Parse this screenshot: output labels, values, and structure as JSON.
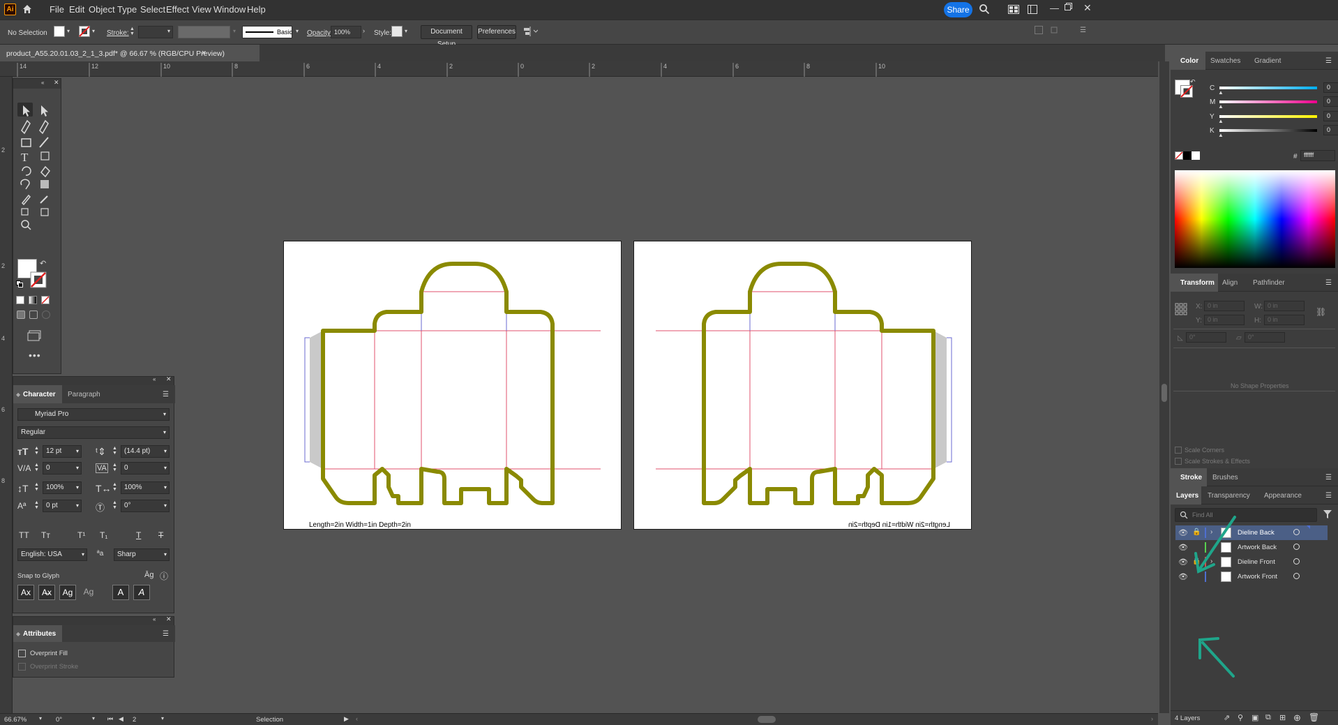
{
  "app": {
    "logo_text": "Ai"
  },
  "menu": [
    "File",
    "Edit",
    "Object",
    "Type",
    "Select",
    "Effect",
    "View",
    "Window",
    "Help"
  ],
  "share_label": "Share",
  "control_bar": {
    "selection_label": "No Selection",
    "stroke_label": "Stroke:",
    "brush_label": "Basic",
    "opacity_label": "Opacity:",
    "opacity_value": "100%",
    "style_label": "Style:",
    "document_setup": "Document Setup",
    "preferences": "Preferences"
  },
  "document_tab": {
    "title": "product_A55.20.01.03_2_1_3.pdf* @ 66.67 % (RGB/CPU Preview)",
    "close": "×"
  },
  "ruler_h": [
    "14",
    "12",
    "10",
    "8",
    "6",
    "4",
    "2",
    "0",
    "2",
    "4",
    "6",
    "8",
    "10"
  ],
  "ruler_v": [
    "2",
    "2",
    "4",
    "6",
    "8"
  ],
  "artboards": {
    "front_text": "Length=2in Width=1in Depth=2in",
    "back_text": "Length=2in Width=1in Depth=2in"
  },
  "character_panel": {
    "tabs": [
      "Character",
      "Paragraph"
    ],
    "font_family": "Myriad Pro",
    "font_style": "Regular",
    "font_size": "12 pt",
    "leading": "(14.4 pt)",
    "kerning": "0",
    "tracking": "0",
    "vscale": "100%",
    "hscale": "100%",
    "baseline": "0 pt",
    "rotation": "0°",
    "language": "English: USA",
    "aa_label": "a",
    "antialias": "Sharp",
    "snap_label": "Snap to Glyph",
    "case_buttons": [
      "TT",
      "Tт",
      "T¹",
      "T₁",
      "T",
      "T"
    ]
  },
  "attributes_panel": {
    "title": "Attributes",
    "overprint_fill": "Overprint Fill",
    "overprint_stroke": "Overprint Stroke"
  },
  "color_panel": {
    "tabs": [
      "Color",
      "Swatches",
      "Gradient"
    ],
    "channels": [
      {
        "label": "C",
        "value": "0",
        "unit": "%"
      },
      {
        "label": "M",
        "value": "0",
        "unit": "%"
      },
      {
        "label": "Y",
        "value": "0",
        "unit": "%"
      },
      {
        "label": "K",
        "value": "0",
        "unit": "%"
      }
    ],
    "hex_label": "#",
    "hex": "ffffff"
  },
  "transform_panel": {
    "tabs": [
      "Transform",
      "Align",
      "Pathfinder"
    ],
    "x_label": "X:",
    "x_value": "0 in",
    "y_label": "Y:",
    "y_value": "0 in",
    "w_label": "W:",
    "w_value": "0 in",
    "h_label": "H:",
    "h_value": "0 in",
    "rot_value": "0°",
    "shear_value": "0°",
    "no_shape": "No Shape Properties",
    "scale_corners": "Scale Corners",
    "scale_strokes": "Scale Strokes & Effects"
  },
  "stroke_tabs": [
    "Stroke",
    "Brushes"
  ],
  "layers_panel": {
    "tabs": [
      "Layers",
      "Transparency",
      "Appearance"
    ],
    "search_placeholder": "Find All",
    "layers": [
      {
        "name": "Dieline Back",
        "color": "#4f6fd0",
        "locked": true,
        "expand": true,
        "selected": true
      },
      {
        "name": "Artwork Back",
        "color": "#57d14f",
        "locked": false,
        "expand": false,
        "selected": false
      },
      {
        "name": "Dieline Front",
        "color": "#d04f4f",
        "locked": true,
        "expand": true,
        "selected": false
      },
      {
        "name": "Artwork Front",
        "color": "#4f6fd0",
        "locked": false,
        "expand": false,
        "selected": false
      }
    ],
    "count_label": "4 Layers"
  },
  "status_bar": {
    "zoom": "66.67%",
    "rotation": "0°",
    "artboard_num": "2",
    "tool": "Selection"
  },
  "colors": {
    "accent": "#1473e6",
    "dieline_stroke": "#8a8a00",
    "fold_line": "#e0506e",
    "annotation_arrow": "#1fa58a"
  }
}
